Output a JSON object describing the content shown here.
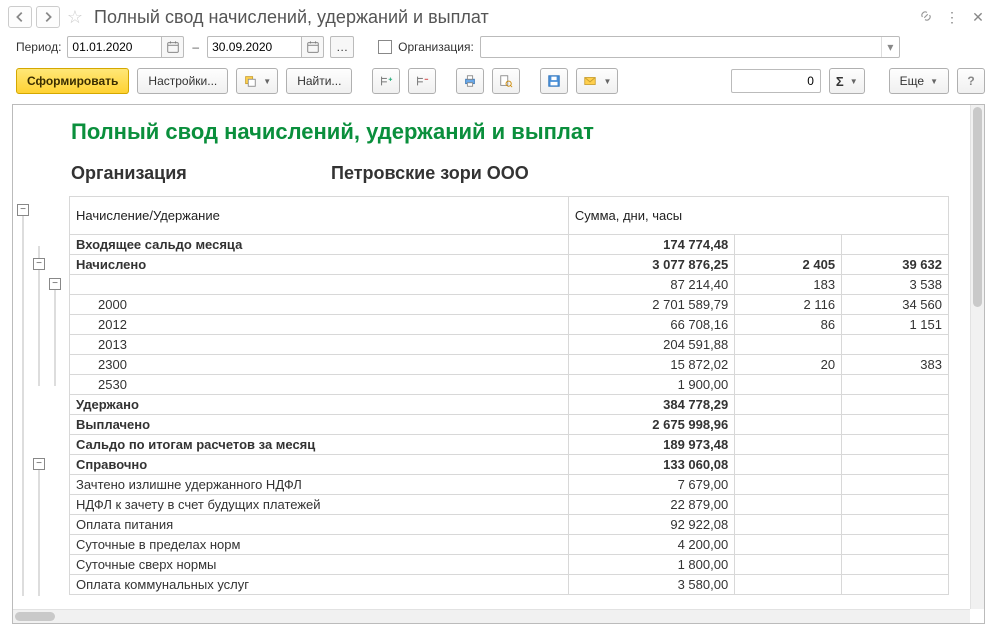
{
  "title": "Полный свод начислений, удержаний и выплат",
  "period": {
    "label": "Период:",
    "from": "01.01.2020",
    "to": "30.09.2020",
    "dash": "–"
  },
  "org_field": {
    "label": "Организация:"
  },
  "toolbar": {
    "generate": "Сформировать",
    "settings": "Настройки...",
    "find": "Найти...",
    "more": "Еще",
    "help": "?",
    "num_value": "0"
  },
  "report": {
    "title": "Полный свод начислений, удержаний и выплат",
    "org_label": "Организация",
    "org_value": "Петровские зори ООО",
    "head_left": "Начисление/Удержание",
    "head_right": "Сумма, дни, часы"
  },
  "rows": [
    {
      "label": "Входящее сальдо месяца",
      "c1": "174 774,48",
      "c2": "",
      "c3": "",
      "bold": true,
      "indent": 0
    },
    {
      "label": "Начислено",
      "c1": "3 077 876,25",
      "c2": "2 405",
      "c3": "39 632",
      "bold": true,
      "indent": 0
    },
    {
      "label": "",
      "c1": "87 214,40",
      "c2": "183",
      "c3": "3 538",
      "bold": false,
      "indent": 0
    },
    {
      "label": "2000",
      "c1": "2 701 589,79",
      "c2": "2 116",
      "c3": "34 560",
      "bold": false,
      "indent": 1
    },
    {
      "label": "2012",
      "c1": "66 708,16",
      "c2": "86",
      "c3": "1 151",
      "bold": false,
      "indent": 1
    },
    {
      "label": "2013",
      "c1": "204 591,88",
      "c2": "",
      "c3": "",
      "bold": false,
      "indent": 1
    },
    {
      "label": "2300",
      "c1": "15 872,02",
      "c2": "20",
      "c3": "383",
      "bold": false,
      "indent": 1
    },
    {
      "label": "2530",
      "c1": "1 900,00",
      "c2": "",
      "c3": "",
      "bold": false,
      "indent": 1
    },
    {
      "label": "Удержано",
      "c1": "384 778,29",
      "c2": "",
      "c3": "",
      "bold": true,
      "indent": 0
    },
    {
      "label": "Выплачено",
      "c1": "2 675 998,96",
      "c2": "",
      "c3": "",
      "bold": true,
      "indent": 0
    },
    {
      "label": "Сальдо по итогам расчетов за месяц",
      "c1": "189 973,48",
      "c2": "",
      "c3": "",
      "bold": true,
      "indent": 0
    },
    {
      "label": "Справочно",
      "c1": "133 060,08",
      "c2": "",
      "c3": "",
      "bold": true,
      "indent": 0
    },
    {
      "label": "Зачтено излишне удержанного НДФЛ",
      "c1": "7 679,00",
      "c2": "",
      "c3": "",
      "bold": false,
      "indent": 0
    },
    {
      "label": "НДФЛ к зачету в счет будущих платежей",
      "c1": "22 879,00",
      "c2": "",
      "c3": "",
      "bold": false,
      "indent": 0
    },
    {
      "label": "Оплата питания",
      "c1": "92 922,08",
      "c2": "",
      "c3": "",
      "bold": false,
      "indent": 0
    },
    {
      "label": "Суточные в пределах норм",
      "c1": "4 200,00",
      "c2": "",
      "c3": "",
      "bold": false,
      "indent": 0
    },
    {
      "label": "Суточные сверх нормы",
      "c1": "1 800,00",
      "c2": "",
      "c3": "",
      "bold": false,
      "indent": 0
    },
    {
      "label": "Оплата коммунальных услуг",
      "c1": "3 580,00",
      "c2": "",
      "c3": "",
      "bold": false,
      "indent": 0
    }
  ]
}
